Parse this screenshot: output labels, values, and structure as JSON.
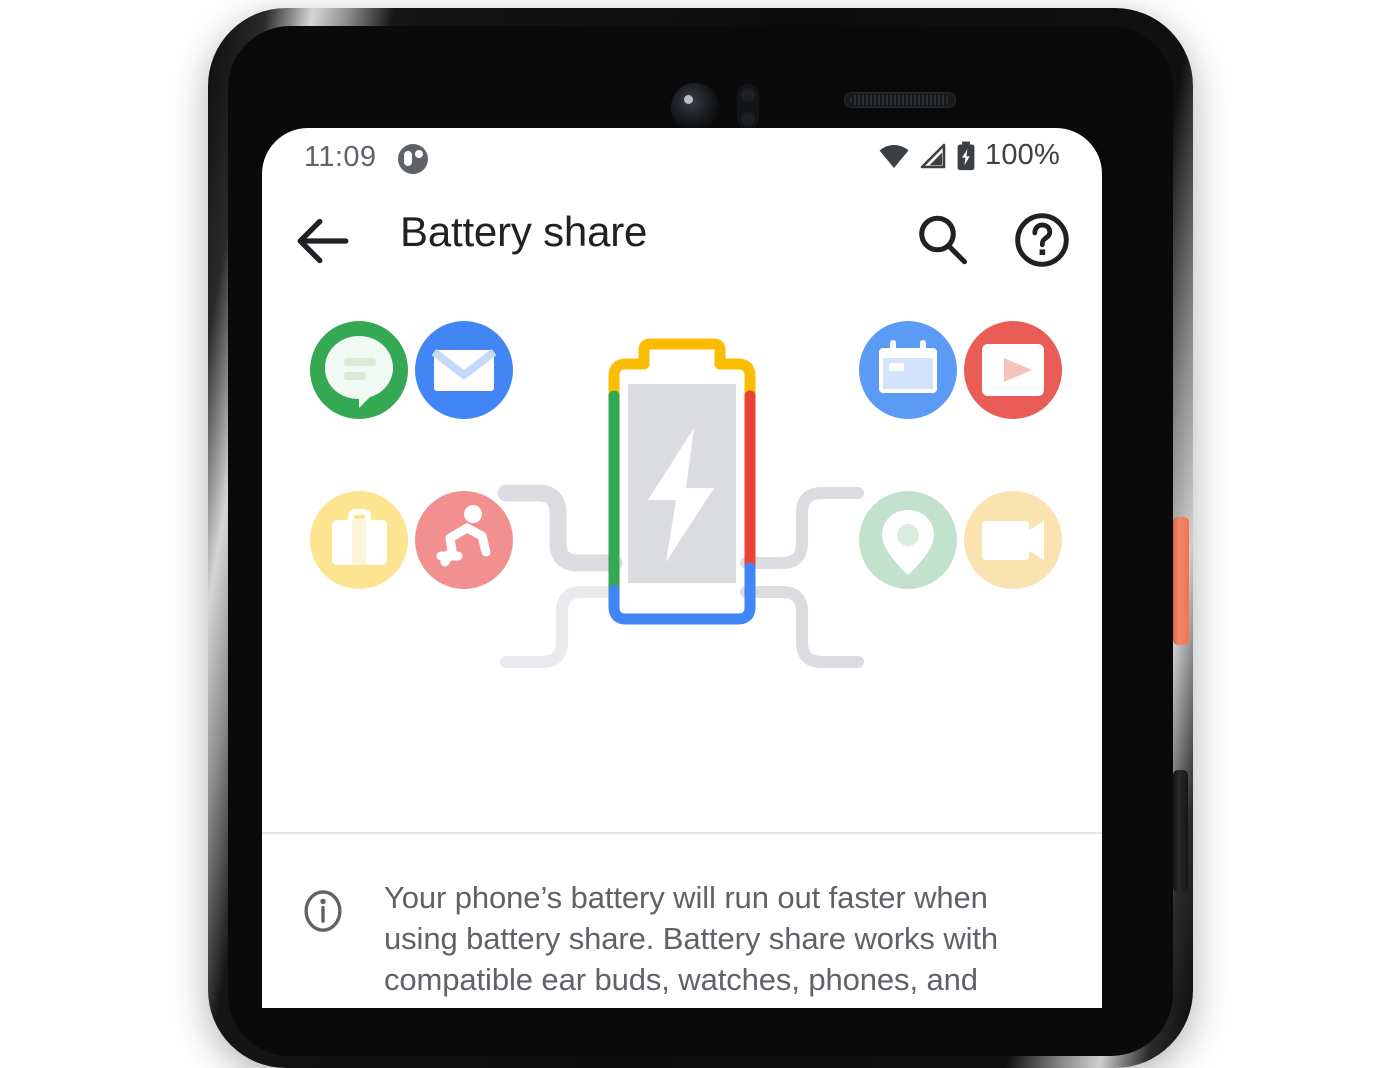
{
  "status_bar": {
    "time": "11:09",
    "notification_icon": "notification-dot-icon",
    "wifi_icon": "wifi-icon",
    "signal_icon": "cell-signal-icon",
    "battery_icon": "battery-charging-icon",
    "battery_percent": "100%"
  },
  "app_bar": {
    "back_icon": "back-arrow-icon",
    "title": "Battery share",
    "search_icon": "search-icon",
    "help_icon": "help-circle-icon"
  },
  "illustration": {
    "name": "battery-share-illustration",
    "battery": {
      "name": "battery-graphic",
      "fill_color": "#dadce0",
      "bolt_color": "#ffffff",
      "stroke_top_color": "#fbbc04",
      "stroke_left_color": "#34a853",
      "stroke_right_color": "#ea4335",
      "stroke_bottom_color": "#4285f4"
    },
    "connectors": {
      "color": "#dadce0",
      "faded_color": "#e8eaed"
    },
    "app_icons": [
      {
        "name": "messages-icon",
        "glyph": "chat-bubble",
        "circle_color": "#34a853",
        "position": "top-left-outer",
        "faded": false
      },
      {
        "name": "mail-icon",
        "glyph": "envelope",
        "circle_color": "#4285f4",
        "position": "top-left-inner",
        "faded": false
      },
      {
        "name": "briefcase-icon",
        "glyph": "briefcase",
        "circle_color": "#fbd966",
        "position": "bottom-left-outer",
        "faded": true
      },
      {
        "name": "fitness-icon",
        "glyph": "running-person",
        "circle_color": "#f08080",
        "position": "bottom-left-inner",
        "faded": true
      },
      {
        "name": "calendar-icon",
        "glyph": "calendar",
        "circle_color": "#5b9bf5",
        "position": "top-right-inner",
        "faded": false
      },
      {
        "name": "youtube-icon",
        "glyph": "play-box",
        "circle_color": "#ea5d57",
        "position": "top-right-outer",
        "faded": false
      },
      {
        "name": "location-icon",
        "glyph": "map-pin",
        "circle_color": "#c3e2cd",
        "position": "bottom-right-inner",
        "faded": true
      },
      {
        "name": "video-icon",
        "glyph": "video-camera",
        "circle_color": "#fae3b0",
        "position": "bottom-right-outer",
        "faded": true
      }
    ]
  },
  "info": {
    "icon": "info-circle-icon",
    "text": "Your phone’s battery will run out faster when using battery share. Battery share works with compatible ear buds, watches, phones, and more."
  },
  "device": {
    "power_button": "power-button",
    "volume_button": "volume-rocker",
    "front_camera": "front-camera",
    "earpiece": "earpiece-speaker"
  }
}
